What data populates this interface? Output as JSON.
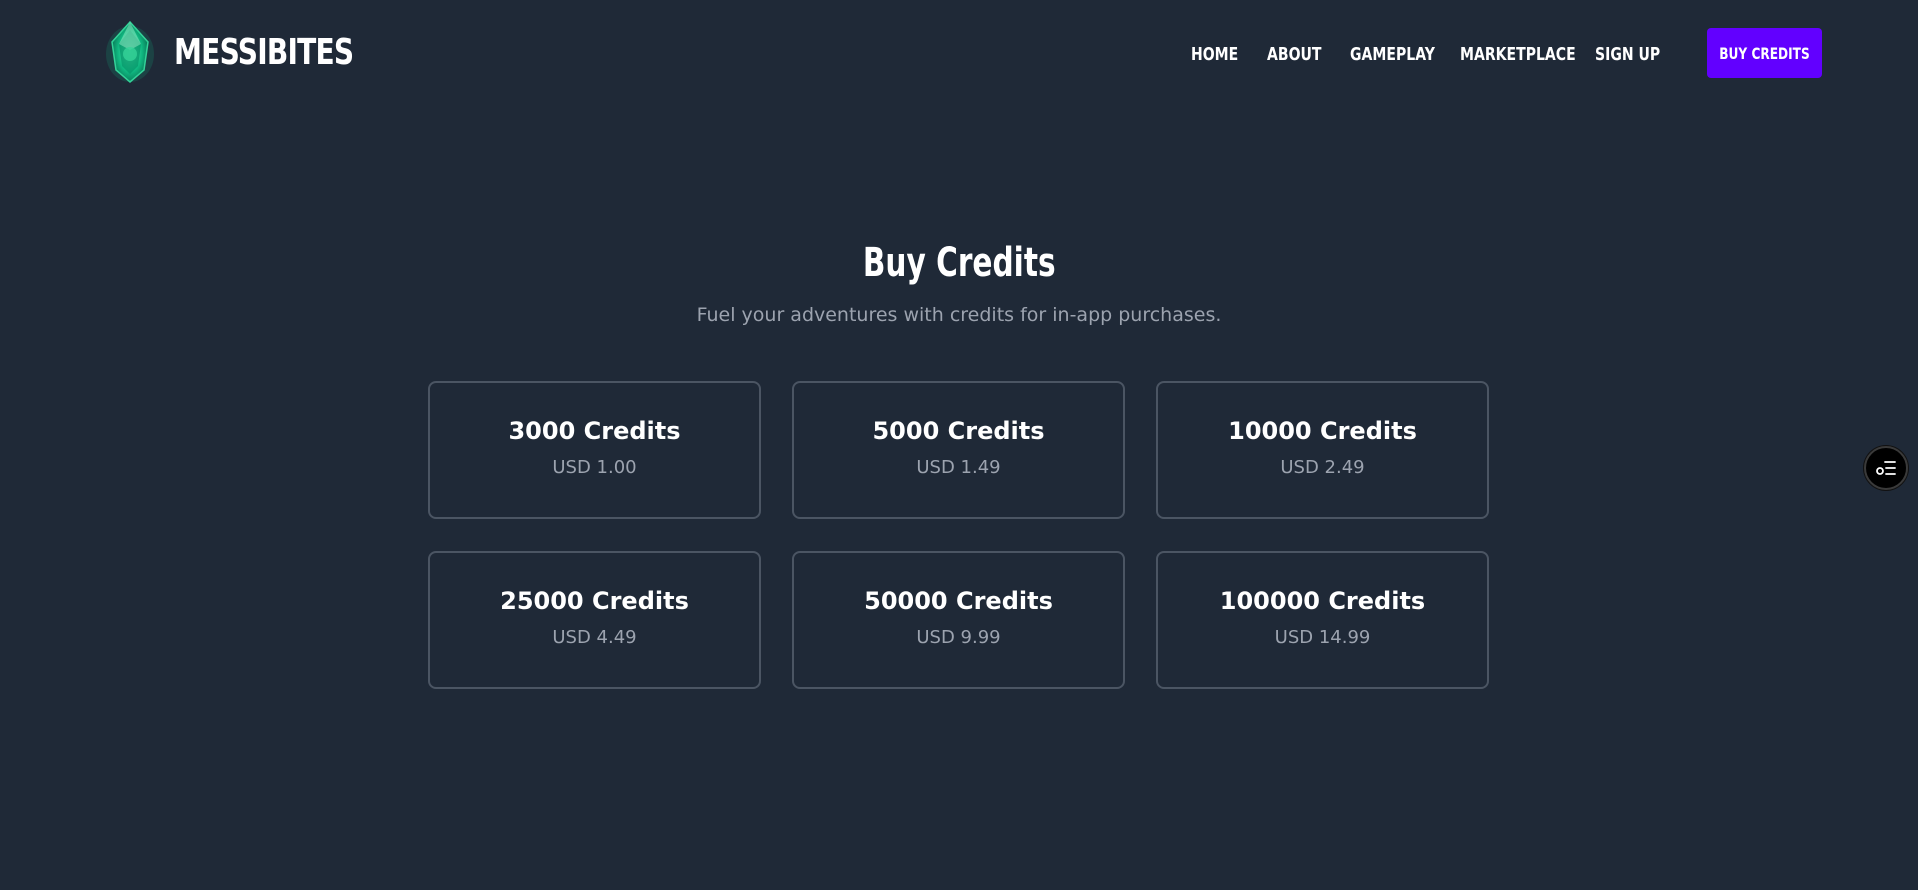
{
  "brand": {
    "name": "MESSIBITES",
    "logo_icon": "emerald-gem-icon",
    "logo_color": "#10b981"
  },
  "nav": {
    "items": [
      {
        "label": "HOME"
      },
      {
        "label": "ABOUT"
      },
      {
        "label": "GAMEPLAY"
      },
      {
        "label": "MARKETPLACE"
      },
      {
        "label": "SIGN UP"
      }
    ],
    "cta_label": "BUY CREDITS",
    "cta_color": "#6200ff"
  },
  "hero": {
    "title": "Buy Credits",
    "subtitle": "Fuel your adventures with credits for in-app purchases."
  },
  "packages": [
    {
      "credits": "3000 Credits",
      "price": "USD 1.00"
    },
    {
      "credits": "5000 Credits",
      "price": "USD 1.49"
    },
    {
      "credits": "10000 Credits",
      "price": "USD 2.49"
    },
    {
      "credits": "25000 Credits",
      "price": "USD 4.49"
    },
    {
      "credits": "50000 Credits",
      "price": "USD 9.99"
    },
    {
      "credits": "100000 Credits",
      "price": "USD 14.99"
    }
  ],
  "widget": {
    "icon": "list-settings-icon"
  },
  "colors": {
    "background": "#1f2937",
    "card_border": "#4b5563",
    "muted_text": "#9ca3af"
  }
}
